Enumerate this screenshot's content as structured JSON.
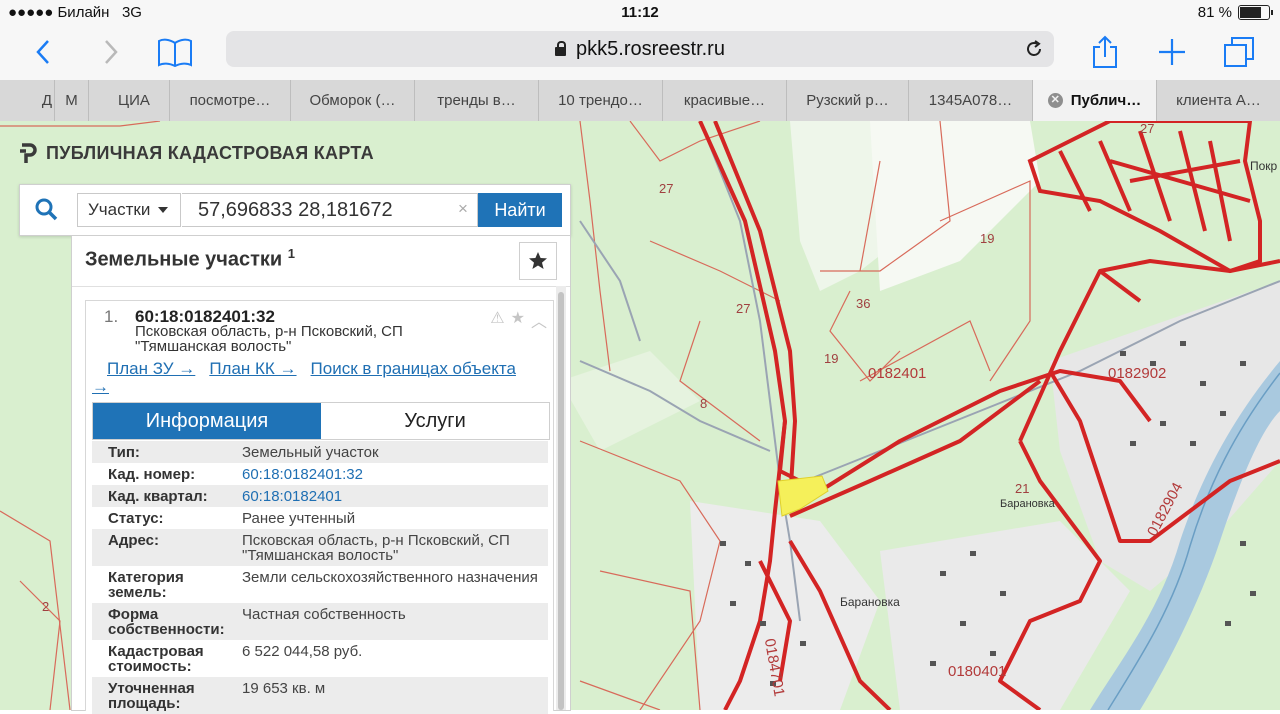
{
  "status": {
    "carrier": "●●●●● Билайн",
    "network": "3G",
    "time": "11:12",
    "battery": "81 %",
    "battery_level": 0.81
  },
  "browser": {
    "url": "pkk5.rosreestr.ru",
    "tabs": [
      {
        "label": "Д"
      },
      {
        "label": "М"
      },
      {
        "label": "ЦИА"
      },
      {
        "label": "посмотре…"
      },
      {
        "label": "Обморок (…"
      },
      {
        "label": "тренды в…"
      },
      {
        "label": "10 трендо…"
      },
      {
        "label": "красивые…"
      },
      {
        "label": "Рузский р…"
      },
      {
        "label": "1345А078…"
      },
      {
        "label": "Публич…"
      },
      {
        "label": "клиента А…"
      }
    ]
  },
  "brand": {
    "title": "ПУБЛИЧНАЯ КАДАСТРОВАЯ КАРТА"
  },
  "search": {
    "type": "Участки",
    "query": "57,696833 28,181672",
    "clear": "×",
    "button": "Найти"
  },
  "panel": {
    "title": "Земельные участки",
    "count": "1",
    "result": {
      "num": "1.",
      "id": "60:18:0182401:32",
      "address": "Псковская область, р-н Псковский, СП \"Тямшанская волость\""
    },
    "links": {
      "plan_zu": "План ЗУ →",
      "plan_kk": "План КК →",
      "search_bounds": "Поиск в границах объекта →"
    },
    "tabs": {
      "info": "Информация",
      "services": "Услуги"
    },
    "info": [
      {
        "k": "Тип:",
        "v": "Земельный участок"
      },
      {
        "k": "Кад. номер:",
        "v": "60:18:0182401:32"
      },
      {
        "k": "Кад. квартал:",
        "v": "60:18:0182401"
      },
      {
        "k": "Статус:",
        "v": "Ранее учтенный"
      },
      {
        "k": "Адрес:",
        "v": "Псковская область, р-н Псковский, СП \"Тямшанская волость\""
      },
      {
        "k": "Категория земель:",
        "v": "Земли сельскохозяйственного назначения"
      },
      {
        "k": "Форма собственности:",
        "v": "Частная собственность"
      },
      {
        "k": "Кадастровая стоимость:",
        "v": "6 522 044,58 руб."
      },
      {
        "k": "Уточненная площадь:",
        "v": "19 653 кв. м"
      }
    ]
  },
  "map_labels": {
    "q1": "0182401",
    "q2": "0182902",
    "q3": "0182904",
    "q4": "0184701",
    "q5": "0180401",
    "n27a": "27",
    "n27b": "27",
    "n19a": "19",
    "n19b": "19",
    "n36": "36",
    "n8": "8",
    "n21": "21",
    "n2": "2",
    "n27c": "27",
    "baranovka1": "Барановка",
    "baranovka2": "Барановка",
    "pokr": "Покр"
  }
}
